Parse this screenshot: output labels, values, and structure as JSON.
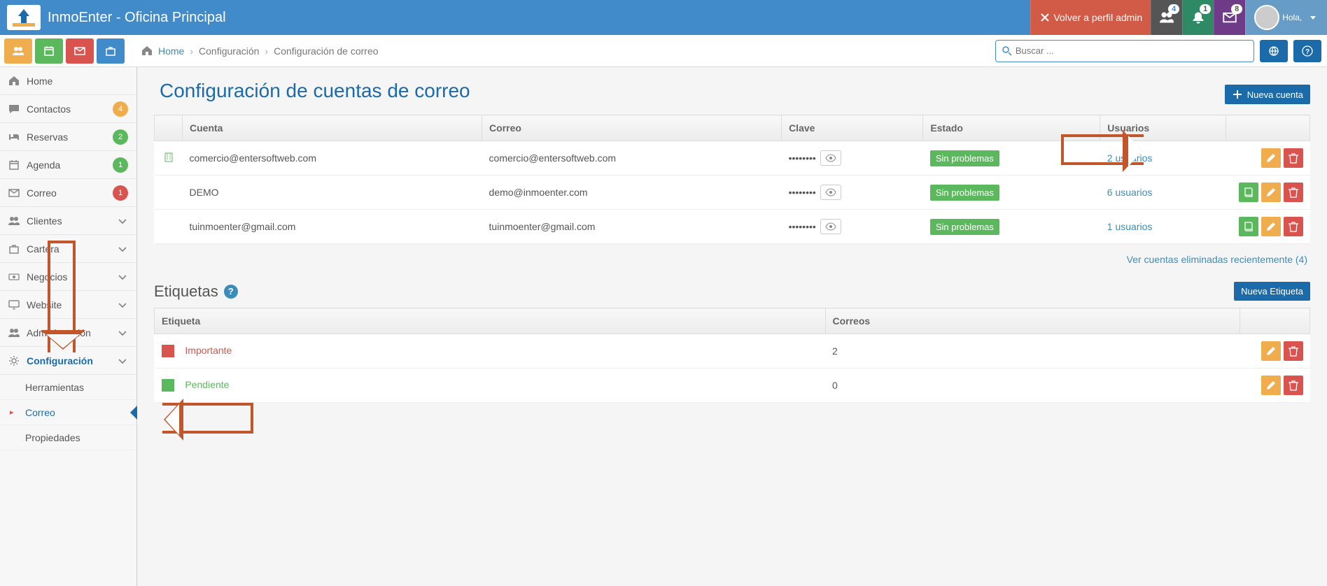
{
  "brand": {
    "title": "InmoEnter - Oficina Principal"
  },
  "topbar": {
    "back_admin": "Volver a perfil admin",
    "users_badge": "4",
    "bell_badge": "1",
    "mail_badge": "8",
    "hello": "Hola,",
    "username": ""
  },
  "breadcrumb": {
    "home": "Home",
    "level1": "Configuración",
    "level2": "Configuración de correo"
  },
  "search": {
    "placeholder": "Buscar ..."
  },
  "sidebar": {
    "items": [
      {
        "label": "Home",
        "icon": "home"
      },
      {
        "label": "Contactos",
        "icon": "comment",
        "badge": "4",
        "badge_cls": "org"
      },
      {
        "label": "Reservas",
        "icon": "bed",
        "badge": "2",
        "badge_cls": "grn"
      },
      {
        "label": "Agenda",
        "icon": "calendar",
        "badge": "1",
        "badge_cls": "grn"
      },
      {
        "label": "Correo",
        "icon": "mail",
        "badge": "1",
        "badge_cls": "red"
      },
      {
        "label": "Clientes",
        "icon": "users",
        "chev": true
      },
      {
        "label": "Cartera",
        "icon": "briefcase",
        "chev": true
      },
      {
        "label": "Negocios",
        "icon": "money",
        "chev": true
      },
      {
        "label": "Website",
        "icon": "desktop",
        "chev": true
      },
      {
        "label": "Administración",
        "icon": "users",
        "chev": true
      },
      {
        "label": "Configuración",
        "icon": "cogs",
        "chev": true,
        "active": true
      }
    ],
    "sub": [
      {
        "label": "Herramientas"
      },
      {
        "label": "Correo",
        "active": true
      },
      {
        "label": "Propiedades"
      }
    ]
  },
  "page": {
    "title": "Configuración de cuentas de correo",
    "new_account_btn": "Nueva cuenta",
    "deleted_link": "Ver cuentas eliminadas recientemente (4)",
    "labels_title": "Etiquetas",
    "new_label_btn": "Nueva Etiqueta"
  },
  "accounts_table": {
    "headers": {
      "cuenta": "Cuenta",
      "correo": "Correo",
      "clave": "Clave",
      "estado": "Estado",
      "usuarios": "Usuarios"
    },
    "rows": [
      {
        "icon": true,
        "cuenta": "comercio@entersoftweb.com",
        "correo": "comercio@entersoftweb.com",
        "clave": "••••••••",
        "estado": "Sin problemas",
        "usuarios": "2 usuarios",
        "actions": [
          "edit",
          "delete"
        ]
      },
      {
        "icon": false,
        "cuenta": "DEMO",
        "correo": "demo@inmoenter.com",
        "clave": "••••••••",
        "estado": "Sin problemas",
        "usuarios": "6 usuarios",
        "actions": [
          "book",
          "edit",
          "delete"
        ]
      },
      {
        "icon": false,
        "cuenta": "tuinmoenter@gmail.com",
        "correo": "tuinmoenter@gmail.com",
        "clave": "••••••••",
        "estado": "Sin problemas",
        "usuarios": "1 usuarios",
        "actions": [
          "book",
          "edit",
          "delete"
        ]
      }
    ]
  },
  "labels_table": {
    "headers": {
      "etiqueta": "Etiqueta",
      "correos": "Correos"
    },
    "rows": [
      {
        "color": "#d9534f",
        "name": "Importante",
        "name_cls": "tag-red",
        "count": "2"
      },
      {
        "color": "#5cb85c",
        "name": "Pendiente",
        "name_cls": "tag-green",
        "count": "0"
      }
    ]
  }
}
